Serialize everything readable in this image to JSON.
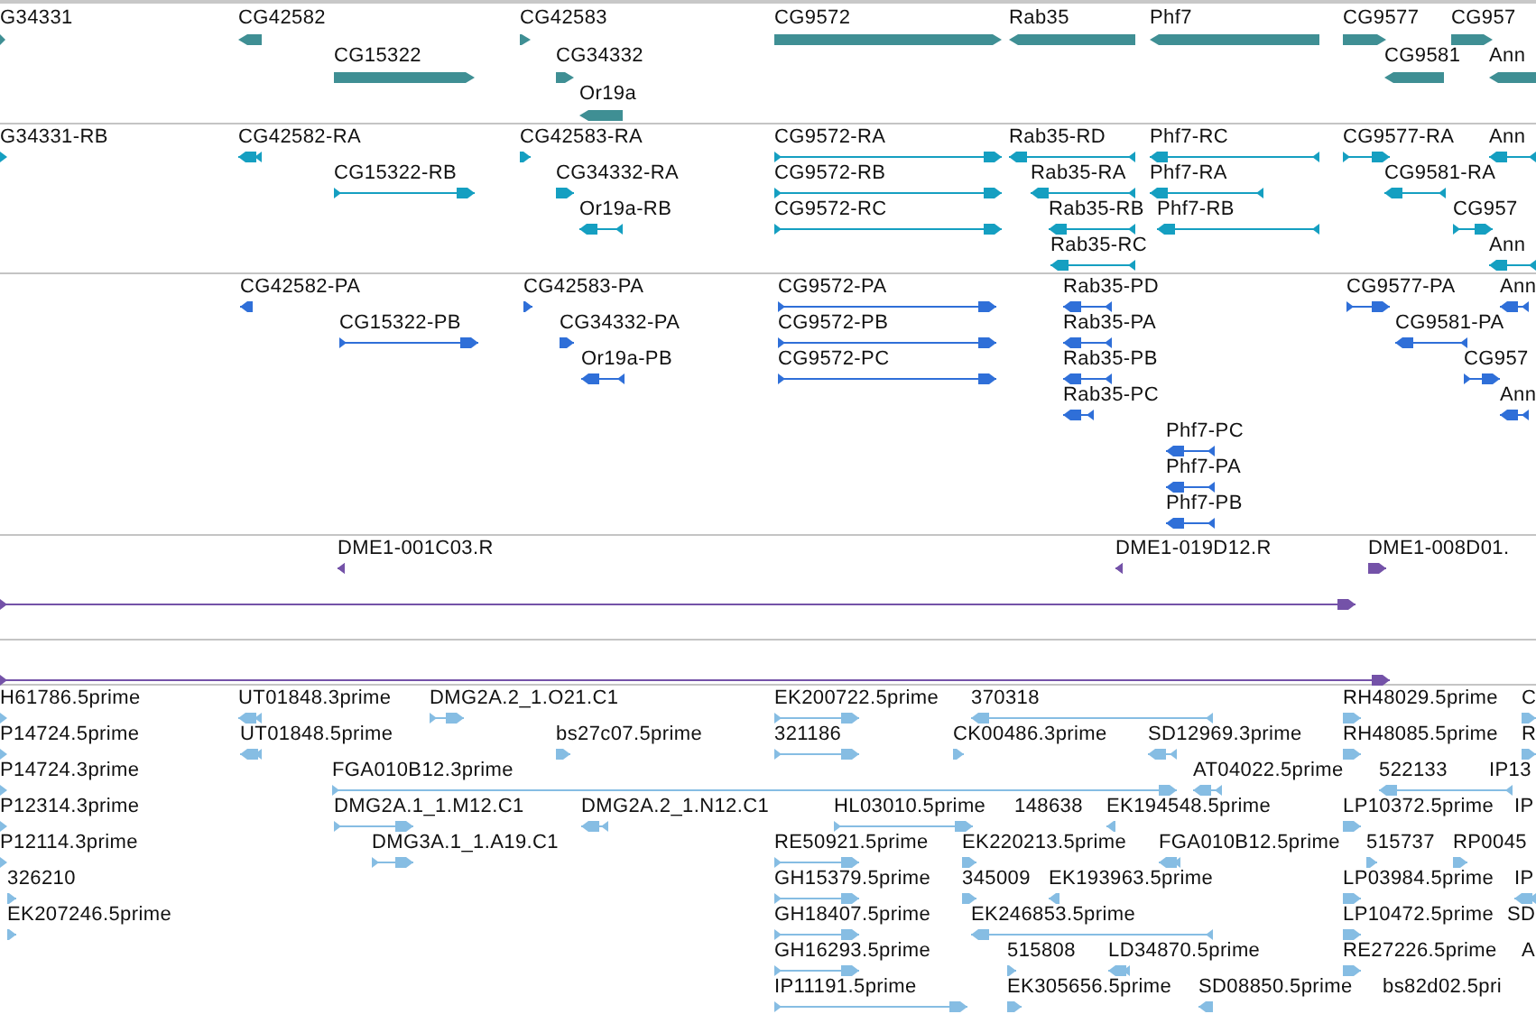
{
  "tracks": [
    {
      "kind": "gene",
      "color": "#3f8f94",
      "features": [
        {
          "label": "G34331",
          "reverse": false
        },
        {
          "label": "CG42582",
          "reverse": true
        },
        {
          "label": "CG42583",
          "reverse": false
        },
        {
          "label": "CG15322",
          "reverse": false
        },
        {
          "label": "CG34332",
          "reverse": false
        },
        {
          "label": "Or19a",
          "reverse": true
        },
        {
          "label": "CG9572",
          "reverse": false
        },
        {
          "label": "Rab35",
          "reverse": true
        },
        {
          "label": "Phf7",
          "reverse": true
        },
        {
          "label": "CG9577",
          "reverse": false
        },
        {
          "label": "CG957",
          "reverse": false
        },
        {
          "label": "CG9581",
          "reverse": true
        },
        {
          "label": "Ann",
          "reverse": true
        }
      ]
    },
    {
      "kind": "transcript",
      "color": "#159fc1",
      "features": [
        {
          "label": "G34331-RB",
          "reverse": false
        },
        {
          "label": "CG42582-RA",
          "reverse": true
        },
        {
          "label": "CG42583-RA",
          "reverse": false
        },
        {
          "label": "CG15322-RB",
          "reverse": false
        },
        {
          "label": "CG34332-RA",
          "reverse": false
        },
        {
          "label": "Or19a-RB",
          "reverse": true
        },
        {
          "label": "CG9572-RA",
          "reverse": false
        },
        {
          "label": "CG9572-RB",
          "reverse": false
        },
        {
          "label": "CG9572-RC",
          "reverse": false
        },
        {
          "label": "Rab35-RD",
          "reverse": true
        },
        {
          "label": "Rab35-RA",
          "reverse": true
        },
        {
          "label": "Rab35-RB",
          "reverse": true
        },
        {
          "label": "Rab35-RC",
          "reverse": true
        },
        {
          "label": "Phf7-RC",
          "reverse": true
        },
        {
          "label": "Phf7-RA",
          "reverse": true
        },
        {
          "label": "Phf7-RB",
          "reverse": true
        },
        {
          "label": "CG9577-RA",
          "reverse": false
        },
        {
          "label": "Ann",
          "reverse": true
        },
        {
          "label": "CG9581-RA",
          "reverse": true
        },
        {
          "label": "CG957",
          "reverse": false
        },
        {
          "label": "Ann",
          "reverse": true
        }
      ]
    },
    {
      "kind": "transcript",
      "color": "#2f6fd8",
      "features": [
        {
          "label": "CG42582-PA",
          "reverse": true
        },
        {
          "label": "CG42583-PA",
          "reverse": false
        },
        {
          "label": "CG15322-PB",
          "reverse": false
        },
        {
          "label": "CG34332-PA",
          "reverse": false
        },
        {
          "label": "Or19a-PB",
          "reverse": true
        },
        {
          "label": "CG9572-PA",
          "reverse": false
        },
        {
          "label": "CG9572-PB",
          "reverse": false
        },
        {
          "label": "CG9572-PC",
          "reverse": false
        },
        {
          "label": "Rab35-PD",
          "reverse": true
        },
        {
          "label": "Rab35-PA",
          "reverse": true
        },
        {
          "label": "Rab35-PB",
          "reverse": true
        },
        {
          "label": "Rab35-PC",
          "reverse": true
        },
        {
          "label": "Phf7-PC",
          "reverse": true
        },
        {
          "label": "Phf7-PA",
          "reverse": true
        },
        {
          "label": "Phf7-PB",
          "reverse": true
        },
        {
          "label": "CG9577-PA",
          "reverse": false
        },
        {
          "label": "Ann",
          "reverse": true
        },
        {
          "label": "CG9581-PA",
          "reverse": true
        },
        {
          "label": "CG957",
          "reverse": false
        },
        {
          "label": "Ann",
          "reverse": true
        }
      ]
    },
    {
      "kind": "transcript",
      "color": "#7452a8",
      "features": [
        {
          "label": "DME1-001C03.R",
          "reverse": true
        },
        {
          "label": "DME1-019D12.R",
          "reverse": true
        },
        {
          "label": "DME1-008D01.",
          "reverse": false
        },
        {
          "reverse": false
        }
      ]
    },
    {
      "kind": "transcript",
      "color": "#7452a8",
      "features": [
        {
          "reverse": false
        }
      ]
    },
    {
      "kind": "transcript",
      "color": "#86bde3",
      "features": [
        {
          "label": "H61786.5prime",
          "reverse": false
        },
        {
          "label": "UT01848.3prime",
          "reverse": true
        },
        {
          "label": "DMG2A.2_1.O21.C1",
          "reverse": false
        },
        {
          "label": "EK200722.5prime",
          "reverse": false
        },
        {
          "label": "370318",
          "reverse": true
        },
        {
          "label": "RH48029.5prime",
          "reverse": false
        },
        {
          "label": "C",
          "reverse": false
        },
        {
          "label": "P14724.5prime",
          "reverse": false
        },
        {
          "label": "UT01848.5prime",
          "reverse": true
        },
        {
          "label": "bs27c07.5prime",
          "reverse": false
        },
        {
          "label": "321186",
          "reverse": false
        },
        {
          "label": "CK00486.3prime",
          "reverse": false
        },
        {
          "label": "SD12969.3prime",
          "reverse": true
        },
        {
          "label": "RH48085.5prime",
          "reverse": false
        },
        {
          "label": "R",
          "reverse": false
        },
        {
          "label": "P14724.3prime",
          "reverse": false
        },
        {
          "label": "FGA010B12.3prime",
          "reverse": false
        },
        {
          "label": "AT04022.5prime",
          "reverse": true
        },
        {
          "label": "522133",
          "reverse": true
        },
        {
          "label": "IP13"
        },
        {
          "label": "P12314.3prime",
          "reverse": false
        },
        {
          "label": "DMG2A.1_1.M12.C1",
          "reverse": false
        },
        {
          "label": "DMG2A.2_1.N12.C1",
          "reverse": true
        },
        {
          "label": "HL03010.5prime",
          "reverse": false
        },
        {
          "label": "148638"
        },
        {
          "label": "EK194548.5prime",
          "reverse": true
        },
        {
          "label": "LP10372.5prime",
          "reverse": false
        },
        {
          "label": "IP"
        },
        {
          "label": "P12114.3prime",
          "reverse": false
        },
        {
          "label": "DMG3A.1_1.A19.C1",
          "reverse": false
        },
        {
          "label": "RE50921.5prime",
          "reverse": false
        },
        {
          "label": "EK220213.5prime",
          "reverse": false
        },
        {
          "label": "FGA010B12.5prime",
          "reverse": true
        },
        {
          "label": "515737",
          "reverse": false
        },
        {
          "label": "RP0045",
          "reverse": false
        },
        {
          "label": "326210",
          "reverse": false
        },
        {
          "label": "GH15379.5prime",
          "reverse": false
        },
        {
          "label": "345009",
          "reverse": false
        },
        {
          "label": "EK193963.5prime",
          "reverse": true
        },
        {
          "label": "LP03984.5prime",
          "reverse": false
        },
        {
          "label": "IP",
          "reverse": true
        },
        {
          "label": "EK207246.5prime",
          "reverse": false
        },
        {
          "label": "GH18407.5prime",
          "reverse": false
        },
        {
          "label": "EK246853.5prime",
          "reverse": true
        },
        {
          "label": "LP10472.5prime",
          "reverse": false
        },
        {
          "label": "SD"
        },
        {
          "label": "GH16293.5prime",
          "reverse": false
        },
        {
          "label": "515808",
          "reverse": false
        },
        {
          "label": "LD34870.5prime",
          "reverse": true
        },
        {
          "label": "RE27226.5prime",
          "reverse": false
        },
        {
          "label": "A"
        },
        {
          "label": "IP11191.5prime",
          "reverse": false
        },
        {
          "label": "EK305656.5prime",
          "reverse": false
        },
        {
          "label": "SD08850.5prime",
          "reverse": true
        },
        {
          "label": "bs82d02.5pri"
        }
      ]
    }
  ]
}
